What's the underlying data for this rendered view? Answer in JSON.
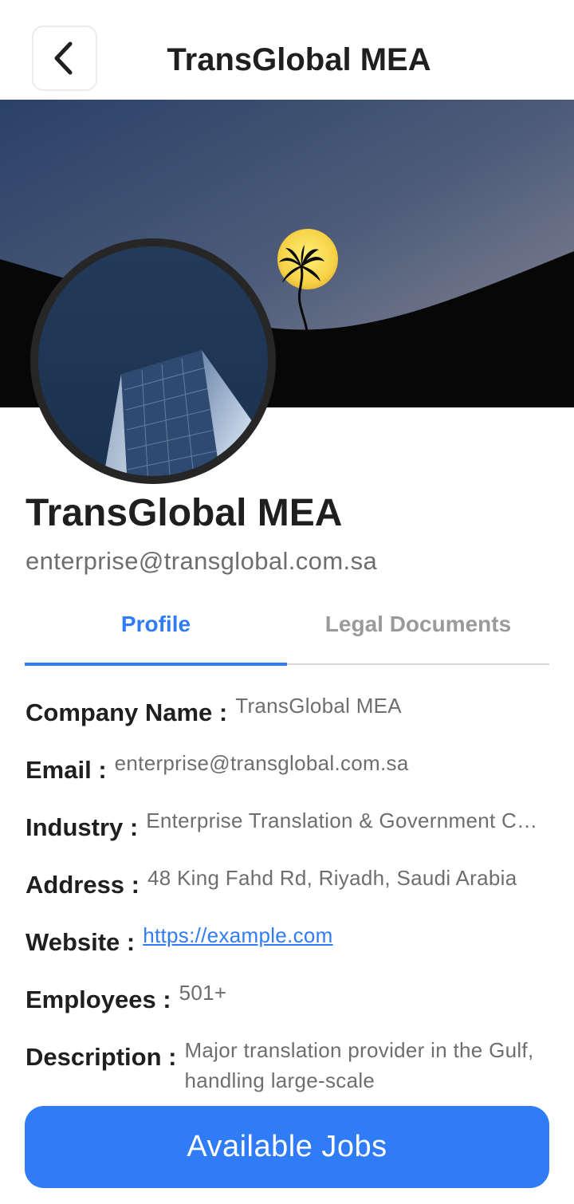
{
  "header": {
    "title": "TransGlobal MEA",
    "back_icon": "chevron-left-icon"
  },
  "profile": {
    "name": "TransGlobal MEA",
    "email": "enterprise@transglobal.com.sa"
  },
  "tabs": [
    {
      "label": "Profile",
      "active": true
    },
    {
      "label": "Legal Documents",
      "active": false
    }
  ],
  "details": {
    "company_name": {
      "label": "Company Name :",
      "value": "TransGlobal MEA"
    },
    "email": {
      "label": "Email :",
      "value": "enterprise@transglobal.com.sa"
    },
    "industry": {
      "label": "Industry :",
      "value": "Enterprise Translation & Government Contracts"
    },
    "address": {
      "label": "Address :",
      "value": "48 King Fahd Rd, Riyadh, Saudi Arabia"
    },
    "website": {
      "label": "Website :",
      "value": "https://example.com"
    },
    "employees": {
      "label": "Employees :",
      "value": "501+"
    },
    "description": {
      "label": "Description :",
      "value": "Major translation provider in the Gulf, handling large-scale"
    }
  },
  "actions": {
    "available_jobs": "Available Jobs"
  },
  "colors": {
    "accent": "#2f7cf6",
    "text_primary": "#1f1f1f",
    "text_secondary": "#6e6e6e",
    "tab_inactive": "#9a9a9a"
  }
}
